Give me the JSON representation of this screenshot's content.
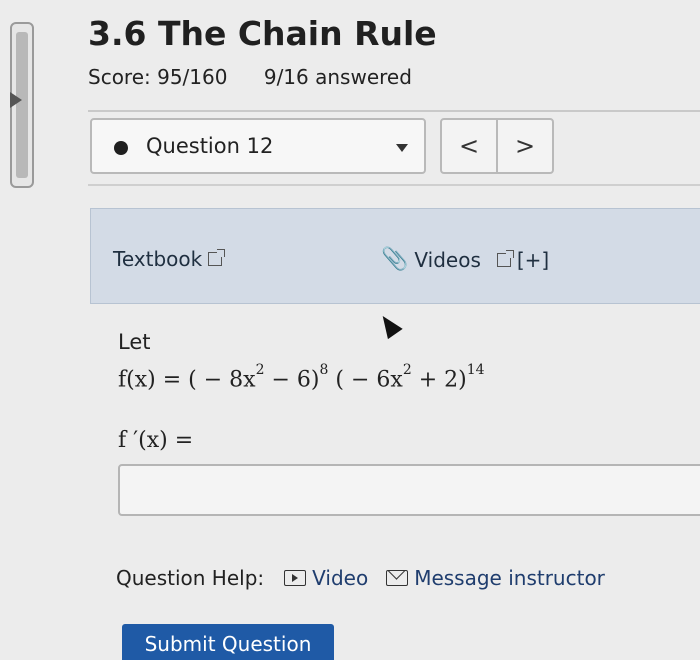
{
  "header": {
    "title": "3.6 The Chain Rule",
    "score": "Score: 95/160",
    "answered": "9/16 answered"
  },
  "question_nav": {
    "selected": "Question 12",
    "prev_label": "<",
    "next_label": ">"
  },
  "resources": {
    "textbook_label": "Textbook",
    "videos_label": "Videos",
    "expand_label": "[+]"
  },
  "question": {
    "intro": "Let",
    "function_name": "f(x) = ",
    "term1_base": "( − 8x",
    "term1_inner_exp": "2",
    "term1_rest": " − 6)",
    "term1_exp": "8",
    "term2_base": "( − 6x",
    "term2_inner_exp": "2",
    "term2_rest": " + 2)",
    "term2_exp": "14",
    "derivative_label": "f ′(x) = ",
    "answer_value": ""
  },
  "help": {
    "label": "Question Help:",
    "video_label": "Video",
    "message_label": "Message instructor"
  },
  "submit_label": "Submit Question"
}
